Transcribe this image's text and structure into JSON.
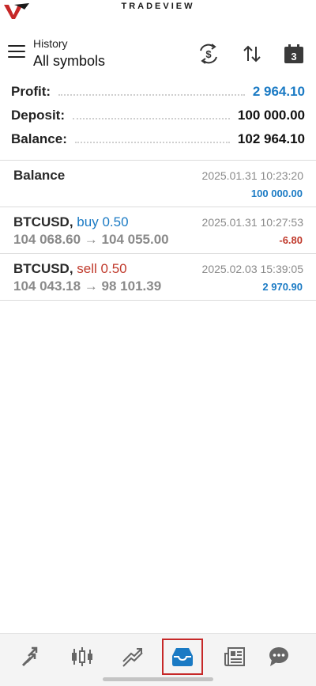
{
  "brand": {
    "name": "TRADEVIEW"
  },
  "header": {
    "subtitle": "History",
    "title": "All symbols",
    "calendar_day": "3"
  },
  "summary": [
    {
      "label": "Profit:",
      "value": "2 964.10",
      "accent": true
    },
    {
      "label": "Deposit:",
      "value": "100 000.00",
      "accent": false
    },
    {
      "label": "Balance:",
      "value": "102 964.10",
      "accent": false
    }
  ],
  "deals": [
    {
      "symbol": "Balance",
      "direction": "",
      "volume": "",
      "prices": "",
      "time": "2025.01.31 10:23:20",
      "amount": "100 000.00",
      "amount_sign": "pos"
    },
    {
      "symbol": "BTCUSD,",
      "direction": "buy",
      "volume": "0.50",
      "prices": "104 068.60 → 104 055.00",
      "time": "2025.01.31 10:27:53",
      "amount": "-6.80",
      "amount_sign": "neg"
    },
    {
      "symbol": "BTCUSD,",
      "direction": "sell",
      "volume": "0.50",
      "prices": "104 043.18 → 98 101.39",
      "time": "2025.02.03 15:39:05",
      "amount": "2 970.90",
      "amount_sign": "pos"
    }
  ],
  "colors": {
    "accent_blue": "#1a7ac4",
    "loss_red": "#c0392b",
    "active_tab_outline": "#c62828"
  },
  "tabs": [
    {
      "icon": "quotes-icon",
      "active": false
    },
    {
      "icon": "chart-icon",
      "active": false
    },
    {
      "icon": "trade-icon",
      "active": false
    },
    {
      "icon": "history-icon",
      "active": true
    },
    {
      "icon": "news-icon",
      "active": false
    },
    {
      "icon": "messages-icon",
      "active": false
    }
  ]
}
